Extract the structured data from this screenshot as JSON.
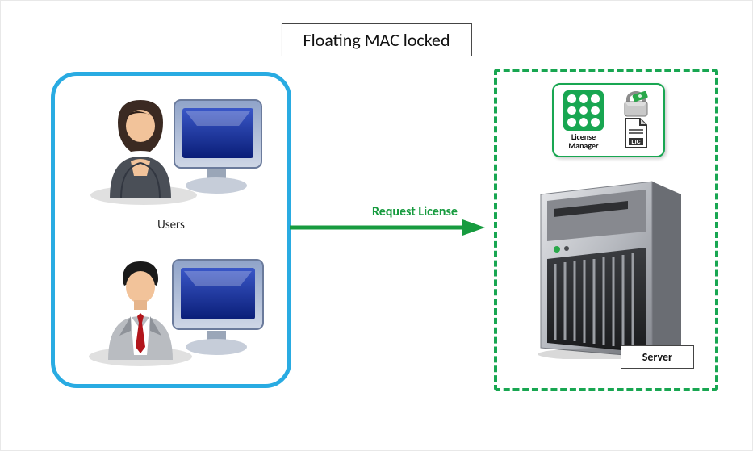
{
  "title": "Floating MAC locked",
  "users_label": "Users",
  "arrow_label": "Request License",
  "lic_caption_line1": "License",
  "lic_caption_line2": "Manager",
  "lic_file_tag": "LIC",
  "server_label": "Server",
  "colors": {
    "accent_blue": "#29abe2",
    "accent_green": "#18a651",
    "arrow_green": "#179b3f"
  }
}
